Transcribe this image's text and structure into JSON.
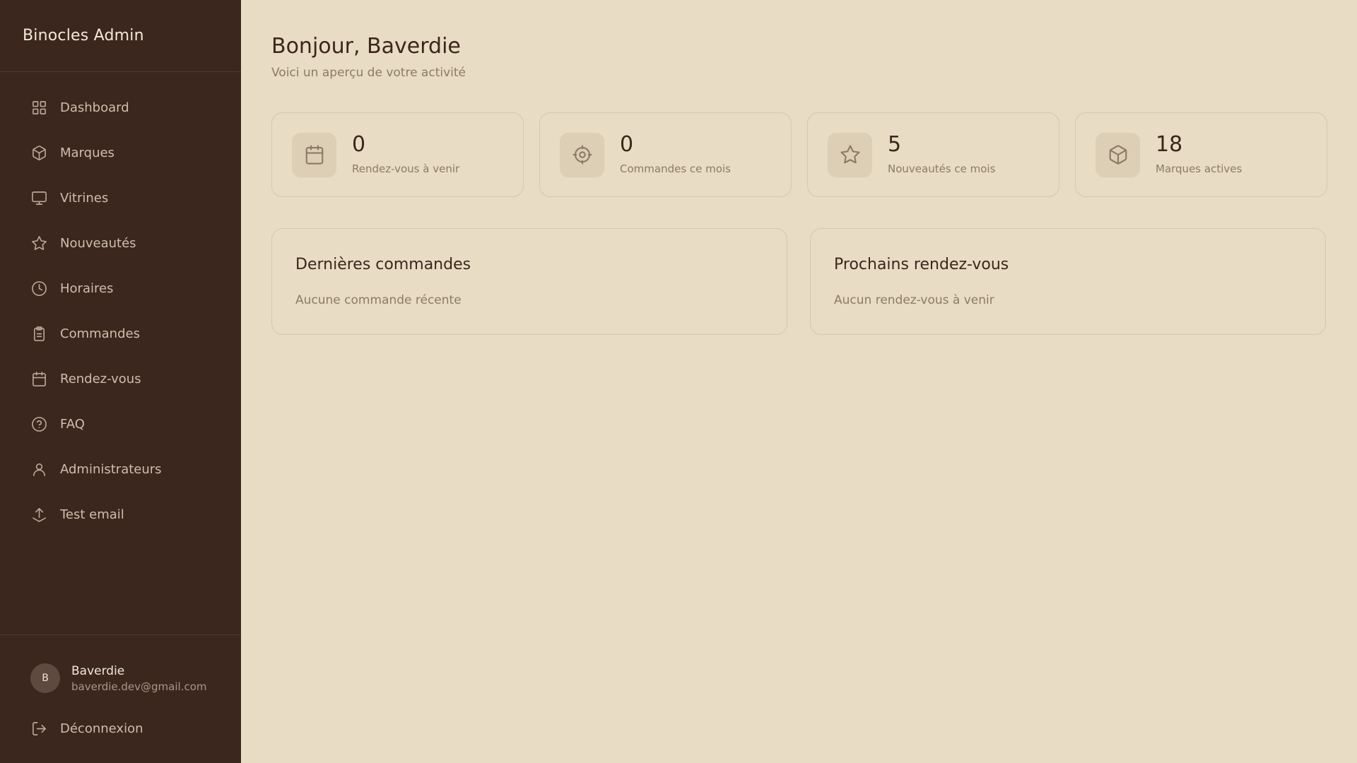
{
  "sidebar": {
    "brand": "Binocles Admin",
    "items": [
      {
        "label": "Dashboard",
        "icon": "grid-icon"
      },
      {
        "label": "Marques",
        "icon": "box-icon"
      },
      {
        "label": "Vitrines",
        "icon": "monitor-icon"
      },
      {
        "label": "Nouveautés",
        "icon": "star-icon"
      },
      {
        "label": "Horaires",
        "icon": "clock-icon"
      },
      {
        "label": "Commandes",
        "icon": "clipboard-icon"
      },
      {
        "label": "Rendez-vous",
        "icon": "calendar-icon"
      },
      {
        "label": "FAQ",
        "icon": "help-circle-icon"
      },
      {
        "label": "Administrateurs",
        "icon": "user-icon"
      },
      {
        "label": "Test email",
        "icon": "upload-icon"
      }
    ],
    "user": {
      "initial": "B",
      "name": "Baverdie",
      "email": "baverdie.dev@gmail.com"
    },
    "logout_label": "Déconnexion"
  },
  "main": {
    "greeting": "Bonjour, Baverdie",
    "subtitle": "Voici un aperçu de votre activité",
    "stats": [
      {
        "value": "0",
        "label": "Rendez-vous à venir",
        "icon": "calendar-icon"
      },
      {
        "value": "0",
        "label": "Commandes ce mois",
        "icon": "target-icon"
      },
      {
        "value": "5",
        "label": "Nouveautés ce mois",
        "icon": "star-icon"
      },
      {
        "value": "18",
        "label": "Marques actives",
        "icon": "box-icon"
      }
    ],
    "panels": [
      {
        "title": "Dernières commandes",
        "empty": "Aucune commande récente"
      },
      {
        "title": "Prochains rendez-vous",
        "empty": "Aucun rendez-vous à venir"
      }
    ]
  },
  "colors": {
    "sidebar_bg": "#3b271d",
    "main_bg": "#e8dcc4",
    "text_dark": "#3b261b",
    "text_muted": "#8c7a68"
  }
}
